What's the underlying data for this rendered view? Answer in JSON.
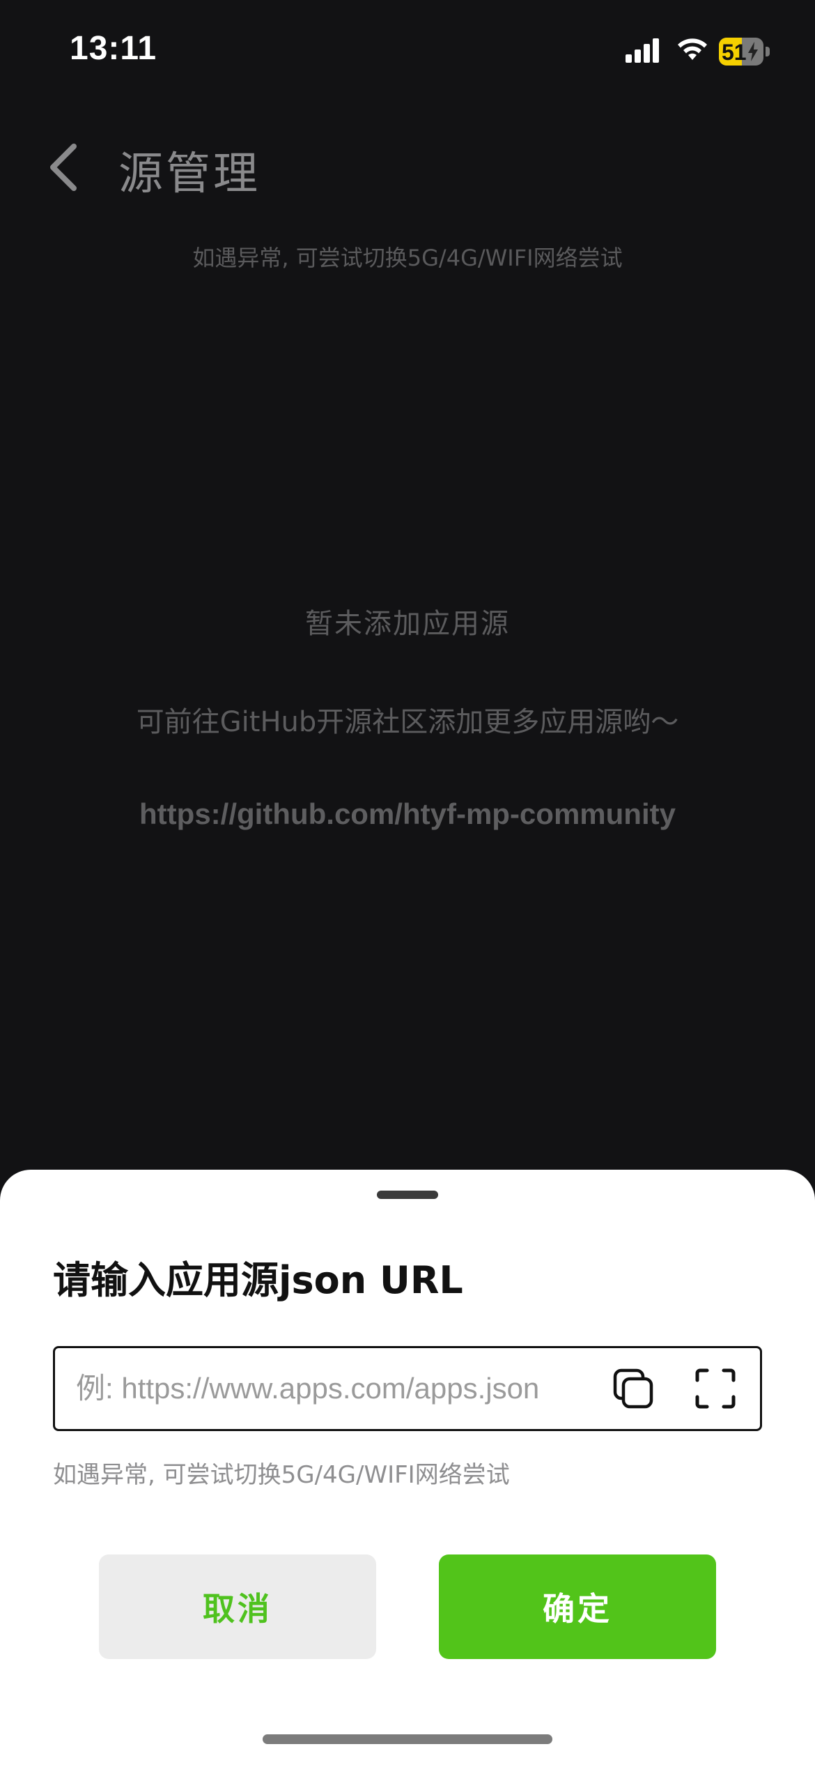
{
  "status_bar": {
    "time": "13:11",
    "battery_percent": 51,
    "battery_text": "51",
    "icons": [
      "signal-icon",
      "wifi-icon",
      "battery-charging-icon"
    ]
  },
  "nav": {
    "back_icon": "chevron-left-icon",
    "title": "源管理",
    "tip": "如遇异常, 可尝试切换5G/4G/WIFI网络尝试"
  },
  "empty_state": {
    "title": "暂未添加应用源",
    "description": "可前往GitHub开源社区添加更多应用源哟～",
    "link": "https://github.com/htyf-mp-community"
  },
  "sheet": {
    "title": "请输入应用源json URL",
    "input": {
      "value": "",
      "placeholder": "例: https://www.apps.com/apps.json"
    },
    "paste_icon": "paste-icon",
    "scan_icon": "scan-icon",
    "tip": "如遇异常, 可尝试切换5G/4G/WIFI网络尝试",
    "cancel_label": "取消",
    "confirm_label": "确定"
  },
  "colors": {
    "background": "#121214",
    "accent": "#52c41a",
    "battery": "#f5d000"
  }
}
